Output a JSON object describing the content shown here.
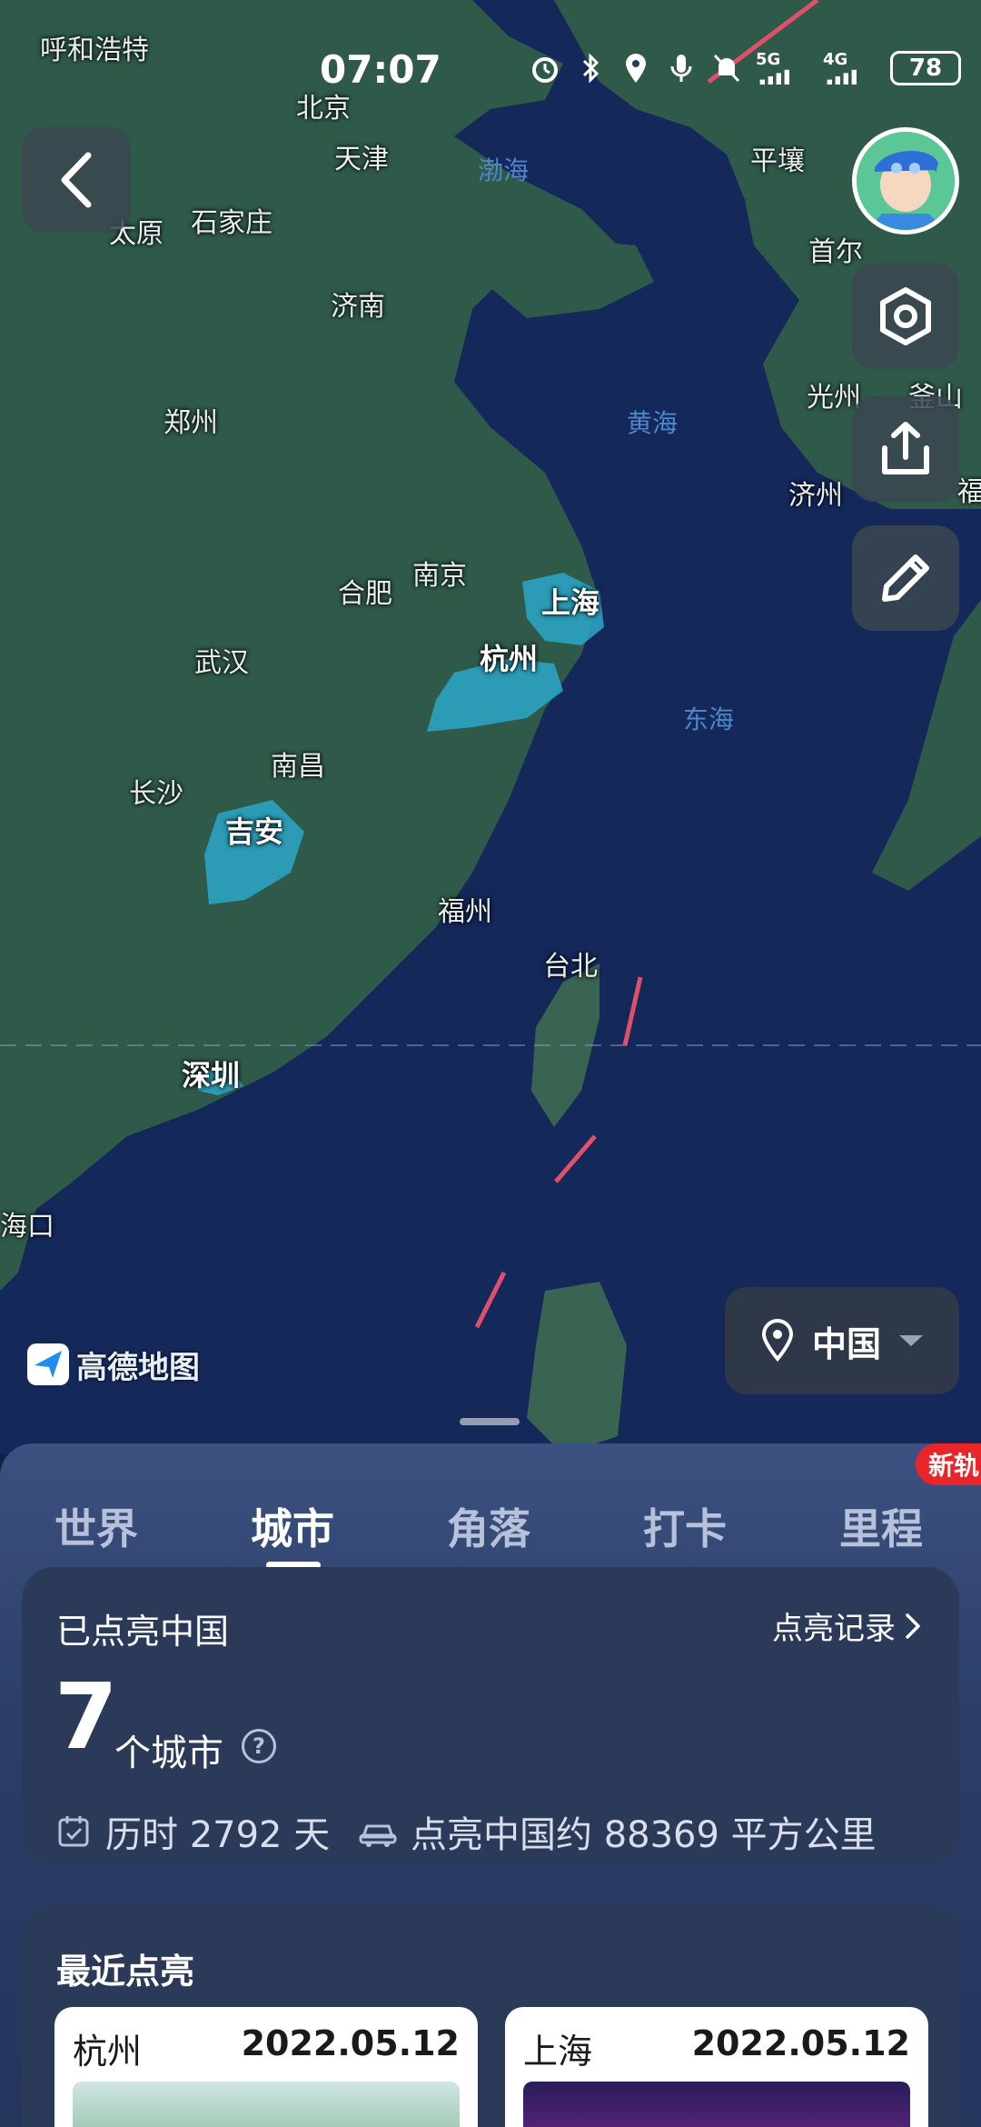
{
  "status_bar": {
    "time": "07:07",
    "network_1": "5G",
    "network_2": "4G",
    "battery": "78",
    "icons": [
      "alarm-icon",
      "bluetooth-icon",
      "location-icon",
      "mic-icon",
      "mute-icon"
    ]
  },
  "map": {
    "provider": "高德地图",
    "region": "中国",
    "city_labels": [
      "呼和浩特",
      "北京",
      "天津",
      "太原",
      "石家庄",
      "济南",
      "郑州",
      "合肥",
      "南京",
      "武汉",
      "南昌",
      "长沙",
      "福州",
      "台北",
      "海口",
      "平壤",
      "首尔",
      "光州",
      "釜山",
      "济州",
      "福"
    ],
    "water_labels": [
      "渤海",
      "黄海",
      "东海"
    ],
    "lit_cities": [
      "上海",
      "杭州",
      "吉安",
      "深圳"
    ],
    "colors": {
      "land": "#2f5a4a",
      "sea": "#14285a",
      "lit": "#2aa7c9",
      "boundary": "#e0506a"
    }
  },
  "tabs": [
    {
      "label": "世界",
      "active": false
    },
    {
      "label": "城市",
      "active": true
    },
    {
      "label": "角落",
      "active": false
    },
    {
      "label": "打卡",
      "active": false
    },
    {
      "label": "里程",
      "active": false
    }
  ],
  "new_badge": "新轨",
  "stats": {
    "title": "已点亮中国",
    "records_link": "点亮记录",
    "count": "7",
    "unit": "个城市",
    "help": "?",
    "days": "历时 2792 天",
    "area": "点亮中国约 88369 平方公里"
  },
  "recent": {
    "title": "最近点亮",
    "items": [
      {
        "city": "杭州",
        "date": "2022.05.12"
      },
      {
        "city": "上海",
        "date": "2022.05.12"
      }
    ]
  }
}
